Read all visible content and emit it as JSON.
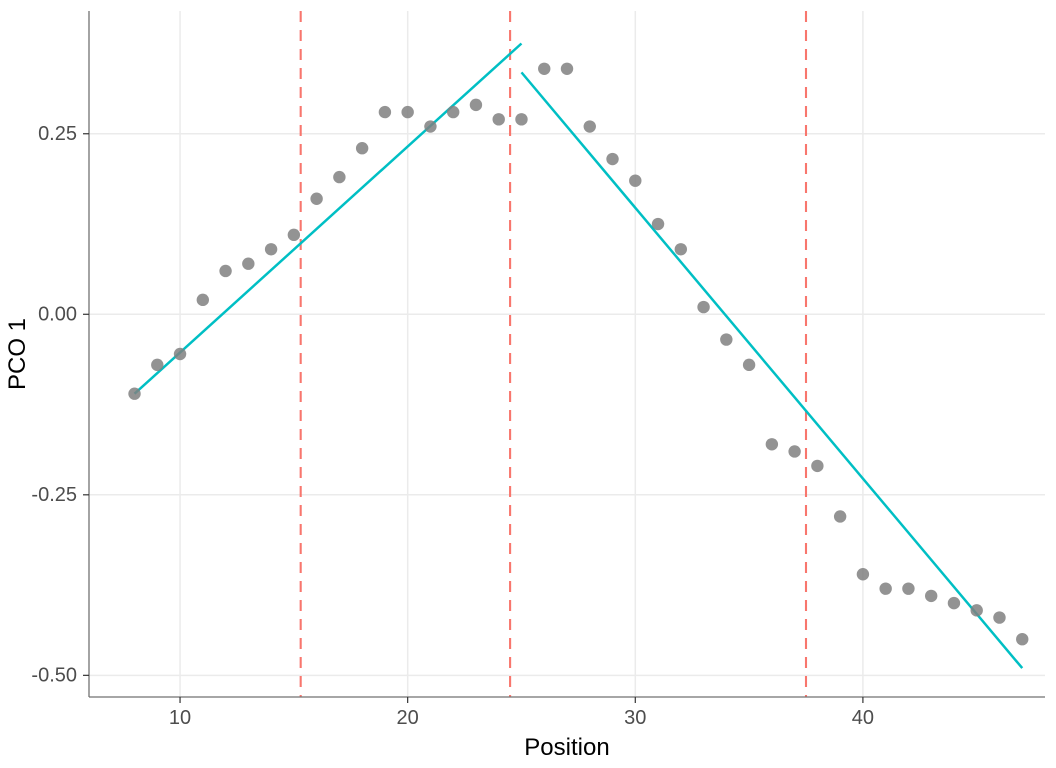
{
  "chart_data": {
    "type": "scatter",
    "xlabel": "Position",
    "ylabel": "PCO 1",
    "title": "",
    "xlim": [
      6,
      48
    ],
    "ylim": [
      -0.53,
      0.42
    ],
    "x_ticks": [
      10,
      20,
      30,
      40
    ],
    "y_ticks": [
      -0.5,
      -0.25,
      0.0,
      0.25
    ],
    "x_ticklabels": [
      "10",
      "20",
      "30",
      "40"
    ],
    "y_ticklabels": [
      "-0.50",
      "-0.25",
      "0.00",
      "0.25"
    ],
    "points": [
      {
        "x": 8,
        "y": -0.11
      },
      {
        "x": 9,
        "y": -0.07
      },
      {
        "x": 10,
        "y": -0.055
      },
      {
        "x": 11,
        "y": 0.02
      },
      {
        "x": 12,
        "y": 0.06
      },
      {
        "x": 13,
        "y": 0.07
      },
      {
        "x": 14,
        "y": 0.09
      },
      {
        "x": 15,
        "y": 0.11
      },
      {
        "x": 16,
        "y": 0.16
      },
      {
        "x": 17,
        "y": 0.19
      },
      {
        "x": 18,
        "y": 0.23
      },
      {
        "x": 19,
        "y": 0.28
      },
      {
        "x": 20,
        "y": 0.28
      },
      {
        "x": 21,
        "y": 0.26
      },
      {
        "x": 22,
        "y": 0.28
      },
      {
        "x": 23,
        "y": 0.29
      },
      {
        "x": 24,
        "y": 0.27
      },
      {
        "x": 25,
        "y": 0.27
      },
      {
        "x": 26,
        "y": 0.34
      },
      {
        "x": 27,
        "y": 0.34
      },
      {
        "x": 28,
        "y": 0.26
      },
      {
        "x": 29,
        "y": 0.215
      },
      {
        "x": 30,
        "y": 0.185
      },
      {
        "x": 31,
        "y": 0.125
      },
      {
        "x": 32,
        "y": 0.09
      },
      {
        "x": 33,
        "y": 0.01
      },
      {
        "x": 34,
        "y": -0.035
      },
      {
        "x": 35,
        "y": -0.07
      },
      {
        "x": 36,
        "y": -0.18
      },
      {
        "x": 37,
        "y": -0.19
      },
      {
        "x": 38,
        "y": -0.21
      },
      {
        "x": 39,
        "y": -0.28
      },
      {
        "x": 40,
        "y": -0.36
      },
      {
        "x": 41,
        "y": -0.38
      },
      {
        "x": 42,
        "y": -0.38
      },
      {
        "x": 43,
        "y": -0.39
      },
      {
        "x": 44,
        "y": -0.4
      },
      {
        "x": 45,
        "y": -0.41
      },
      {
        "x": 46,
        "y": -0.42
      },
      {
        "x": 47,
        "y": -0.45
      }
    ],
    "fit_lines": [
      {
        "x1": 8,
        "y1": -0.11,
        "x2": 25,
        "y2": 0.375
      },
      {
        "x1": 25,
        "y1": 0.335,
        "x2": 47,
        "y2": -0.49
      }
    ],
    "vlines": [
      15.3,
      24.5,
      37.5
    ]
  },
  "axis": {
    "x_label": "Position",
    "y_label": "PCO 1"
  },
  "ticks": {
    "x": [
      "10",
      "20",
      "30",
      "40"
    ],
    "y": [
      "-0.50",
      "-0.25",
      "0.00",
      "0.25"
    ]
  }
}
